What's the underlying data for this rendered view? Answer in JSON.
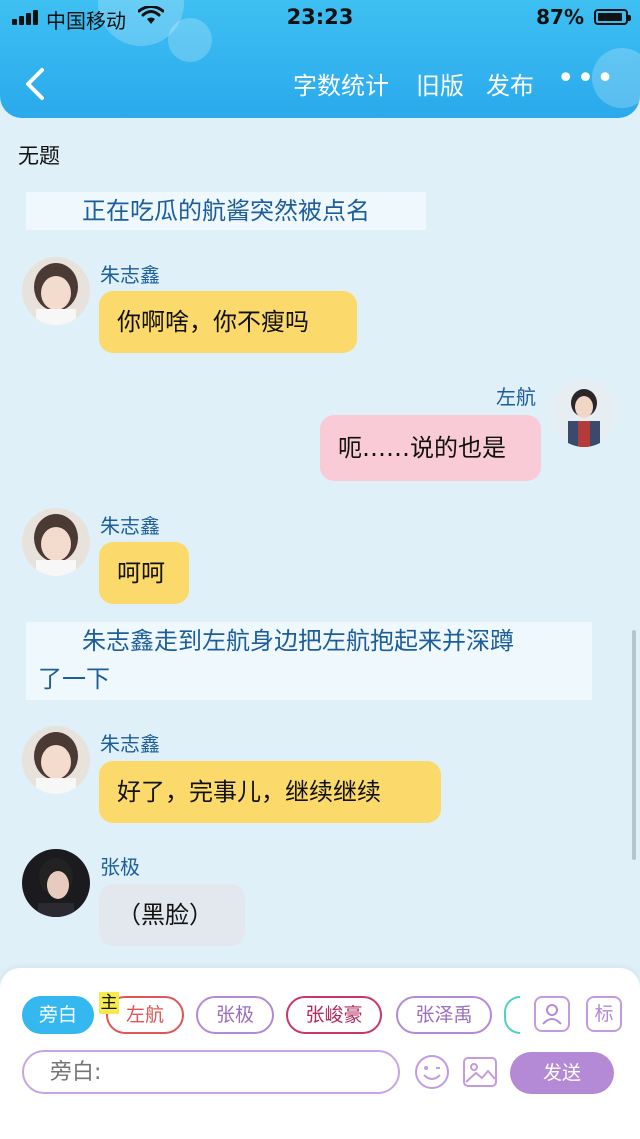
{
  "status_bar": {
    "carrier": "中国移动",
    "time": "23:23",
    "battery": "87%"
  },
  "nav": {
    "word_count": "字数统计",
    "old_version": "旧版",
    "publish": "发布",
    "more": "•••"
  },
  "title": "无题",
  "messages": [
    {
      "type": "narration",
      "text": "正在吃瓜的航酱突然被点名"
    },
    {
      "type": "left",
      "name": "朱志鑫",
      "text": "你啊啥，你不瘦吗"
    },
    {
      "type": "right",
      "name": "左航",
      "text": "呃……说的也是"
    },
    {
      "type": "left",
      "name": "朱志鑫",
      "text": "呵呵"
    },
    {
      "type": "narration",
      "text_line1": "朱志鑫走到左航身边把左航抱起来并深蹲",
      "text_line2": "了一下"
    },
    {
      "type": "left",
      "name": "朱志鑫",
      "text": "好了，完事儿，继续继续"
    },
    {
      "type": "left",
      "name": "张极",
      "text": "（黑脸）"
    }
  ],
  "composer": {
    "role_chips": [
      {
        "label": "旁白",
        "color": "#35b7ef",
        "active": true
      },
      {
        "label": "左航",
        "color": "#e05555"
      },
      {
        "label": "张极",
        "color": "#b48ad6"
      },
      {
        "label": "张峻豪",
        "color": "#c9356c"
      },
      {
        "label": "张泽禹",
        "color": "#b48ad6"
      }
    ],
    "main_badge": "主",
    "tag_button": "标",
    "input_placeholder": "旁白:",
    "send_label": "发送"
  },
  "colors": {
    "header": "#2aa9ec",
    "background": "#dff0f9",
    "narration_text": "#1d5e9a",
    "yellow_bubble": "#fbd96a",
    "pink_bubble": "#f9cbd6",
    "gray_bubble": "#e3e8ee",
    "accent_purple": "#b48ad6"
  }
}
